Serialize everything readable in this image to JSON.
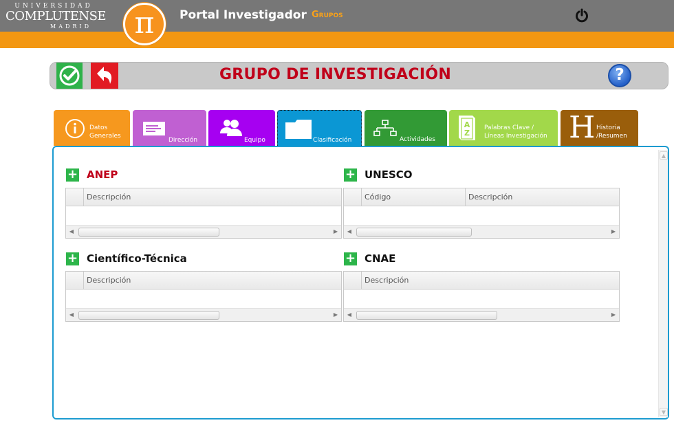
{
  "header": {
    "university": {
      "line1": "UNIVERSIDAD",
      "line2": "COMPLUTENSE",
      "line3": "MADRID"
    },
    "logo_glyph": "π",
    "portal_title": "Portal Investigador",
    "nav_link": "Grupos",
    "power_icon": "power-icon",
    "colors": {
      "topbar": "#777777",
      "accent": "#f39712"
    }
  },
  "actionbar": {
    "title": "GRUPO DE INVESTIGACIÓN",
    "save_icon": "check-icon",
    "back_icon": "undo-arrow-icon",
    "help_label": "?",
    "title_color": "#c0001a"
  },
  "tabs": [
    {
      "line1": "Datos",
      "line2": "Generales",
      "icon": "info-icon",
      "color": "#f6981e"
    },
    {
      "line1": "Dirección",
      "line2": "",
      "icon": "address-card-icon",
      "color": "#c060d2"
    },
    {
      "line1": "Equipo",
      "line2": "",
      "icon": "users-icon",
      "color": "#a600f1"
    },
    {
      "line1": "Clasificación",
      "line2": "",
      "icon": "folder-icon",
      "color": "#0b97d4",
      "active": true
    },
    {
      "line1": "Actividades",
      "line2": "",
      "icon": "hierarchy-icon",
      "color": "#329a35"
    },
    {
      "line1": "Palabras Clave /",
      "line2": "Líneas Investigación",
      "icon": "dictionary-icon",
      "color": "#a2d84a"
    },
    {
      "line1": "Historia",
      "line2": "/Resumen",
      "icon": "letter-h-icon",
      "glyph": "H",
      "color": "#9a5e0b"
    }
  ],
  "sections": {
    "anep": {
      "title": "ANEP",
      "columns": [
        "Descripción"
      ]
    },
    "unesco": {
      "title": "UNESCO",
      "columns": [
        "Código",
        "Descripción"
      ]
    },
    "cientifica": {
      "title": "Científico-Técnica",
      "columns": [
        "Descripción"
      ]
    },
    "cnae": {
      "title": "CNAE",
      "columns": [
        "Descripción"
      ]
    }
  },
  "add_label": "+"
}
